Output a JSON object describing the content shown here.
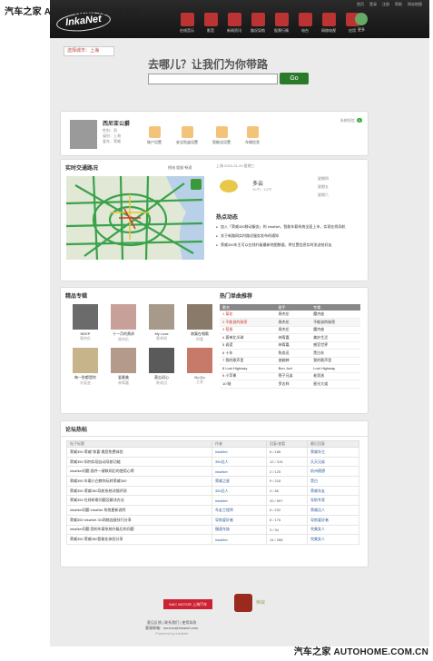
{
  "watermark": {
    "top": "汽车之家 AUTOHOME.COM.CN",
    "bottom": "汽车之家 AUTOHOME.COM.CN"
  },
  "header": {
    "logo": "InkaNet",
    "links": [
      "首页",
      "登录",
      "注册",
      "帮助",
      "网站地图"
    ],
    "nav": [
      {
        "label": "在线音乐",
        "icon": "music-icon"
      },
      {
        "label": "影音",
        "icon": "film-icon"
      },
      {
        "label": "新闻资讯",
        "icon": "news-icon"
      },
      {
        "label": "路况导航",
        "icon": "route-icon"
      },
      {
        "label": "股票行情",
        "icon": "stock-icon"
      },
      {
        "label": "电台",
        "icon": "radio-icon"
      },
      {
        "label": "网络电视",
        "icon": "tv-icon"
      },
      {
        "label": "应用",
        "icon": "apps-icon"
      }
    ],
    "more": "更多"
  },
  "city": "选择城市：上海",
  "slogan": "去哪儿？让我们为你带路",
  "search": {
    "placeholder": "",
    "button": "Go"
  },
  "profile": {
    "name": "西尼亚公爵",
    "info": [
      "性别：男",
      "省份：上海",
      "爱车：荣威"
    ],
    "buttons": [
      "账户设置",
      "安全防盗设置",
      "智能化设置",
      "车辆信息"
    ],
    "status_label": "系统短信",
    "status_count": "0"
  },
  "traffic": {
    "title": "实时交通路况",
    "legend": "拥堵 缓慢 畅通"
  },
  "weather": {
    "date": "上海 2010-01-20 星期三",
    "desc": "多云",
    "temp": "10℃~ 14℃",
    "forecast": [
      "星期四",
      "星期五",
      "星期六"
    ]
  },
  "news": {
    "title": "热点动态",
    "items": [
      "加入「荣威350移动服务」的 inkaNet，智能车载系统全面上市，实现在线导航",
      "关于新路网实时路况服务发布的通知",
      "荣威350车主可以在线升级最新地图数据、将位置信息实时发送给好友"
    ]
  },
  "featured": {
    "title": "精品专辑",
    "albums": [
      {
        "t": "NEEP",
        "a": "周杰伦"
      },
      {
        "t": "十一月的萧邦",
        "a": "周杰伦"
      },
      {
        "t": "My Love",
        "a": "蔡卓妍"
      },
      {
        "t": "寂寞在唱歌",
        "a": "阿桑"
      },
      {
        "t": "每一秒都是你",
        "a": "许茹芸"
      },
      {
        "t": "爱最美",
        "a": "林宥嘉"
      },
      {
        "t": "莫忘初心",
        "a": "陈奕迅"
      },
      {
        "t": "Do Do",
        "a": "王菲"
      }
    ]
  },
  "hot_songs": {
    "title": "热门单曲推荐",
    "headers": [
      "歌名",
      "歌手",
      "专辑"
    ],
    "rows": [
      [
        "1 菊花",
        "周杰伦",
        "魔杰座"
      ],
      [
        "2 不能说的秘密",
        "周杰伦",
        "不能说的秘密"
      ],
      [
        "3 稻香",
        "周杰伦",
        "魔杰座"
      ],
      [
        "4 孤单北半球",
        "林宥嘉",
        "美妙生活"
      ],
      [
        "5 说谎",
        "林宥嘉",
        "感官世界"
      ],
      [
        "6 十年",
        "陈奕迅",
        "黑白灰"
      ],
      [
        "7 我的歌声里",
        "曲婉婷",
        "我的歌声里"
      ],
      [
        "8 Lost Highway",
        "Bon Jovi",
        "Lost Highway"
      ],
      [
        "9 小苹果",
        "筷子兄弟",
        "老男孩"
      ],
      [
        "10 暗",
        "罗志祥",
        "星光大道"
      ]
    ]
  },
  "forum": {
    "title": "论坛热帖",
    "headers": [
      "帖子标题",
      "作者",
      "回复/查看",
      "最后回复"
    ],
    "rows": [
      [
        "荣威350 荣威\"惊喜\"邀您免费体验",
        "inkaNet",
        "6 / 188",
        "荣威车主"
      ],
      [
        "荣威350 如何实现自动导航功能",
        "350达人",
        "12 / 315",
        "天天兄弟"
      ],
      [
        "inkaNet问题 插件一键联网后的使用心得",
        "inkaNet",
        "2 / 125",
        "杭州随想"
      ],
      [
        "荣威350 车载小白教你玩转荣威350",
        "荣威之星",
        "9 / 218",
        "黑白"
      ],
      [
        "荣威350 荣威350导航系统详细评测",
        "350达人",
        "3 / 86",
        "荣威车友"
      ],
      [
        "荣威350 在线听歌问题及解决办法",
        "inkaNet",
        "20 / 597",
        "导航专家"
      ],
      [
        "inkaNet问题 inkaNet 系统更新说明",
        "车友工程师",
        "5 / 232",
        "荣威达人"
      ],
      [
        "荣威350 inkaNet 3G网络连接技巧分享",
        "导航爱好者",
        "8 / 176",
        "导航爱好者"
      ],
      [
        "inkaNet问题 我的车载系统升级后的问题",
        "慢速车族",
        "3 / 94",
        "完美女人"
      ],
      [
        "荣威350 荣威350智能化体验分享",
        "inkaNet",
        "14 / 288",
        "完美女人"
      ]
    ]
  },
  "footer": {
    "brand1": "SAIC MOTOR 上海汽车",
    "brand2": "荣威",
    "links": "意见反馈 | 联系我们 | 使用条款",
    "email": "客服邮箱：service@inkanet.com",
    "copyright": "Powered by inkaNet"
  }
}
